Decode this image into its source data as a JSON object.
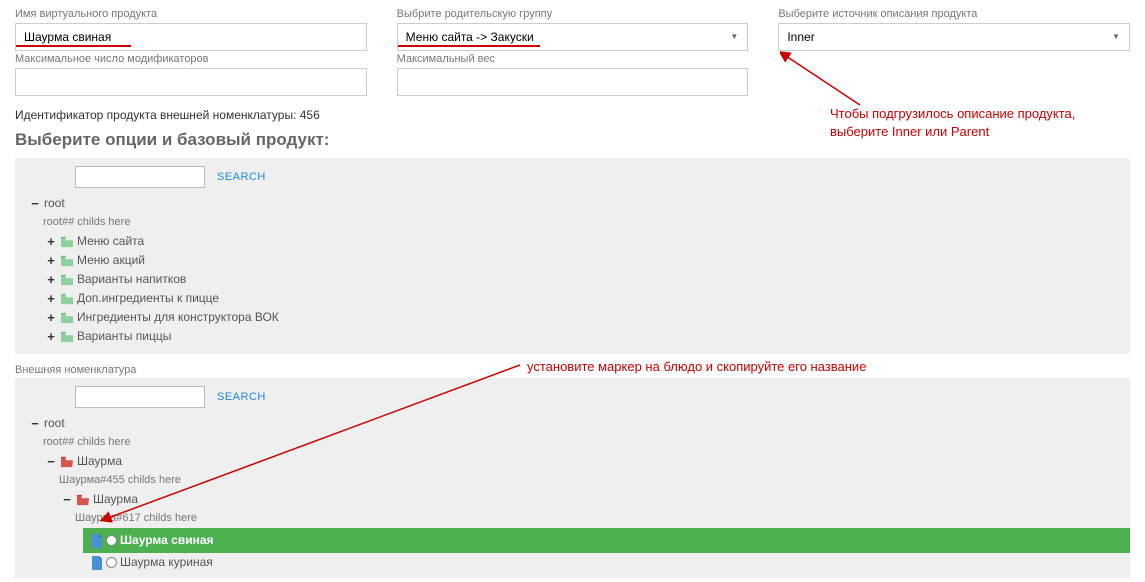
{
  "fields": {
    "name": {
      "label": "Имя виртуального продукта",
      "value": "Шаурма свиная"
    },
    "parentGroup": {
      "label": "Выбрите родительскую группу",
      "value": "Меню сайта -> Закуски"
    },
    "source": {
      "label": "Выберите источник описания продукта",
      "value": "Inner"
    },
    "maxModifiers": {
      "label": "Максимальное число модификаторов",
      "value": ""
    },
    "maxWeight": {
      "label": "Максимальный вес",
      "value": ""
    }
  },
  "identifierLine": "Идентификатор продукта внешней номенклатуры: 456",
  "optionsTitle": "Выберите опции и базовый продукт:",
  "searchLabel": "SEARCH",
  "tree1": {
    "rootLabel": "root",
    "childsHere": "root## childs here",
    "items": [
      "Меню сайта",
      "Меню акций",
      "Варианты напитков",
      "Доп.ингредиенты к пицце",
      "Ингредиенты для конструктора ВОК",
      "Варианты пиццы"
    ]
  },
  "extLabel": "Внешняя номенклатура",
  "tree2": {
    "rootLabel": "root",
    "childsHere": "root## childs here",
    "l1": {
      "label": "Шаурма",
      "childsHere": "Шаурма#455 childs here"
    },
    "l2": {
      "label": "Шаурма",
      "childsHere": "Шаурма#617 childs here"
    },
    "item1": "Шаурма свиная",
    "item2": "Шаурма куриная"
  },
  "annotations": {
    "a1": "Чтобы подгрузилось описание продукта, выберите Inner или Parent",
    "a2": "установите маркер на блюдо и скопируйте его название"
  }
}
